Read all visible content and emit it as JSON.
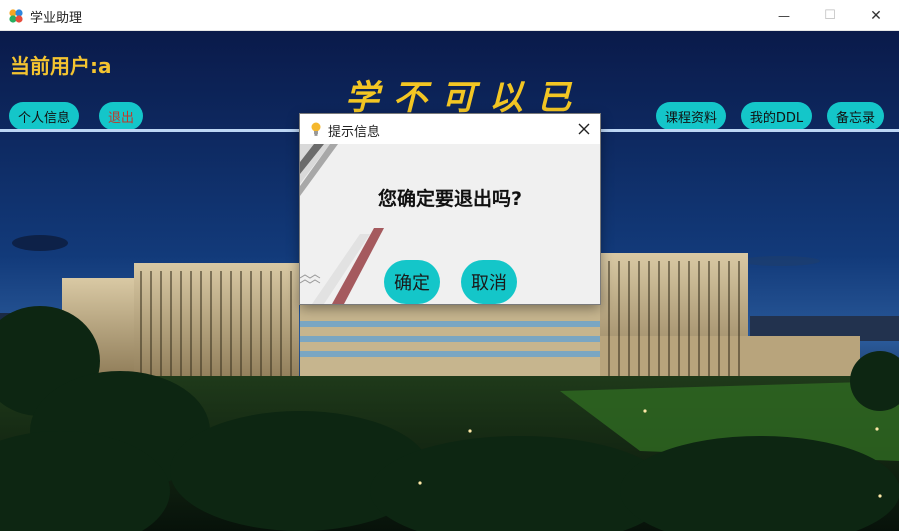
{
  "window": {
    "title": "学业助理",
    "minimize_glyph": "—",
    "maximize_glyph": "☐",
    "close_glyph": "✕"
  },
  "header": {
    "current_user": "当前用户:a",
    "motto": "学不可以已"
  },
  "nav": {
    "profile": "个人信息",
    "logout": "退出",
    "course_materials": "课程资料",
    "my_ddl": "我的DDL",
    "memo": "备忘录"
  },
  "dialog": {
    "title": "提示信息",
    "message": "您确定要退出吗?",
    "confirm": "确定",
    "cancel": "取消"
  },
  "colors": {
    "accent_teal": "#14c6c9",
    "title_gold": "#f4c430",
    "logout_red": "#c0392b",
    "sky_dark": "#0b1a44"
  },
  "icons": {
    "app": "app-logo-icon",
    "dialog": "lightbulb-icon",
    "dialog_close": "close-icon"
  }
}
